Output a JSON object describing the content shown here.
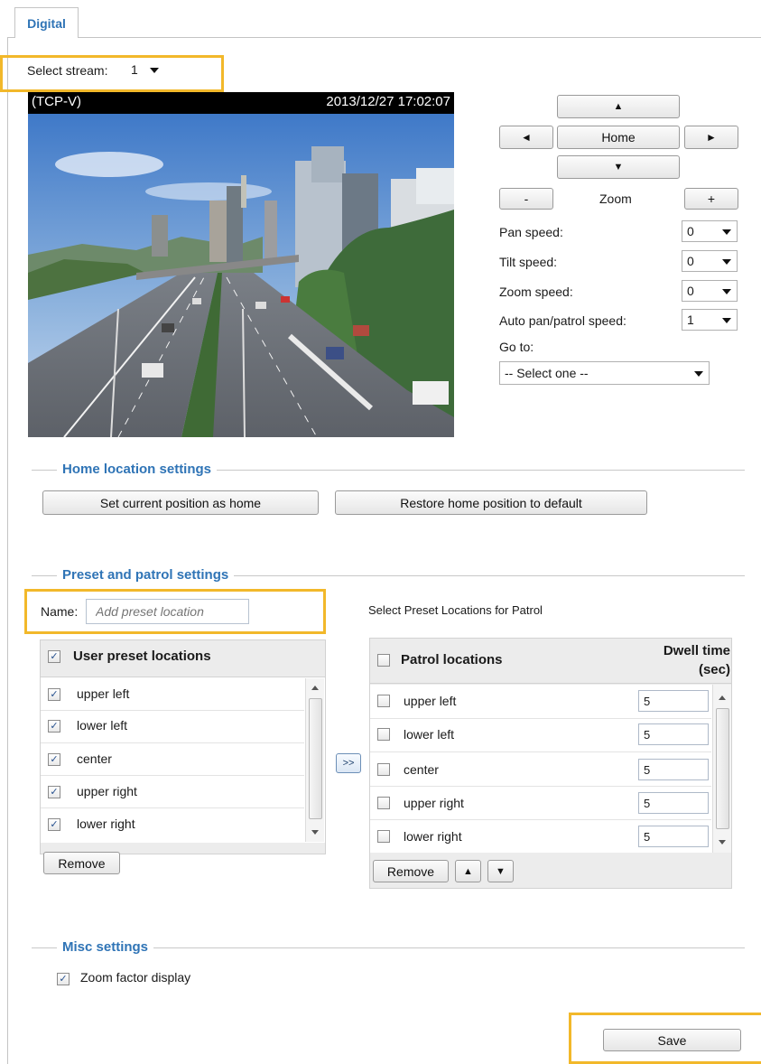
{
  "tab": {
    "label": "Digital"
  },
  "stream": {
    "label": "Select stream:",
    "value": "1"
  },
  "video": {
    "protocol": "(TCP-V)",
    "timestamp": "2013/12/27 17:02:07"
  },
  "ptz": {
    "up": "▲",
    "down": "▼",
    "left": "◄",
    "right": "►",
    "home": "Home",
    "zoom_out": "-",
    "zoom_label": "Zoom",
    "zoom_in": "+"
  },
  "speeds": [
    {
      "label": "Pan speed:",
      "value": "0"
    },
    {
      "label": "Tilt speed:",
      "value": "0"
    },
    {
      "label": "Zoom speed:",
      "value": "0"
    },
    {
      "label": "Auto pan/patrol speed:",
      "value": "1"
    }
  ],
  "goto": {
    "label": "Go to:",
    "value": "-- Select one --"
  },
  "home_section": {
    "title": "Home location settings",
    "set_home": "Set current position as home",
    "restore_home": "Restore home position to default"
  },
  "preset_section": {
    "title": "Preset and patrol settings",
    "name_label": "Name:",
    "name_placeholder": "Add preset location",
    "patrol_caption": "Select Preset Locations for Patrol",
    "user_header": "User preset locations",
    "user_items": [
      "upper left",
      "lower left",
      "center",
      "upper right",
      "lower right"
    ],
    "remove": "Remove",
    "move": ">>",
    "patrol_header": "Patrol locations",
    "dwell_header_1": "Dwell time",
    "dwell_header_2": "(sec)",
    "patrol_items": [
      {
        "label": "upper left",
        "dwell": "5"
      },
      {
        "label": "lower left",
        "dwell": "5"
      },
      {
        "label": "center",
        "dwell": "5"
      },
      {
        "label": "upper right",
        "dwell": "5"
      },
      {
        "label": "lower right",
        "dwell": "5"
      }
    ],
    "patrol_remove": "Remove",
    "order_up": "▲",
    "order_down": "▼"
  },
  "misc_section": {
    "title": "Misc settings",
    "zoom_factor": "Zoom factor display"
  },
  "save": "Save",
  "colors": {
    "accent": "#2f74b6",
    "highlight": "#f2b82a"
  }
}
